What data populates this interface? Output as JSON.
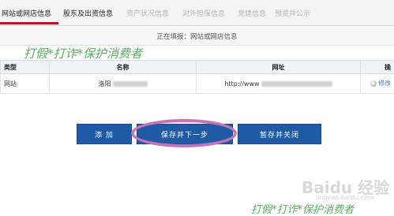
{
  "tabs": [
    {
      "label": "网站或网店信息",
      "active": true
    },
    {
      "label": "股东及出资信息",
      "active": true
    },
    {
      "label": "资产状况信息",
      "active": false
    },
    {
      "label": "对外担保信息",
      "active": false
    },
    {
      "label": "党建信息",
      "active": false
    },
    {
      "label": "预览并公示",
      "active": false
    }
  ],
  "subheader": "正在填报：网站或网店信息",
  "table": {
    "headers": [
      "类型",
      "名称",
      "网址",
      "操"
    ],
    "rows": [
      {
        "type": "网站",
        "name": "洛阳",
        "url": "http://www",
        "action": "修改"
      }
    ]
  },
  "buttons": {
    "add": "添 加",
    "save_next": "保存并下一步",
    "save_close": "暂存并关闭"
  },
  "watermarks": {
    "top": "打假*打诈*保护消费者",
    "bottom": "打假*打诈*保护消费者",
    "baidu": "Baidu 经验",
    "baidu_sub": "jingyan.baidu.com"
  },
  "colors": {
    "active_tab_underline": "#b31b1b",
    "button_blue": "#1f5aa6",
    "highlight_ellipse": "#c773b6",
    "watermark_green": "#3ca046"
  }
}
